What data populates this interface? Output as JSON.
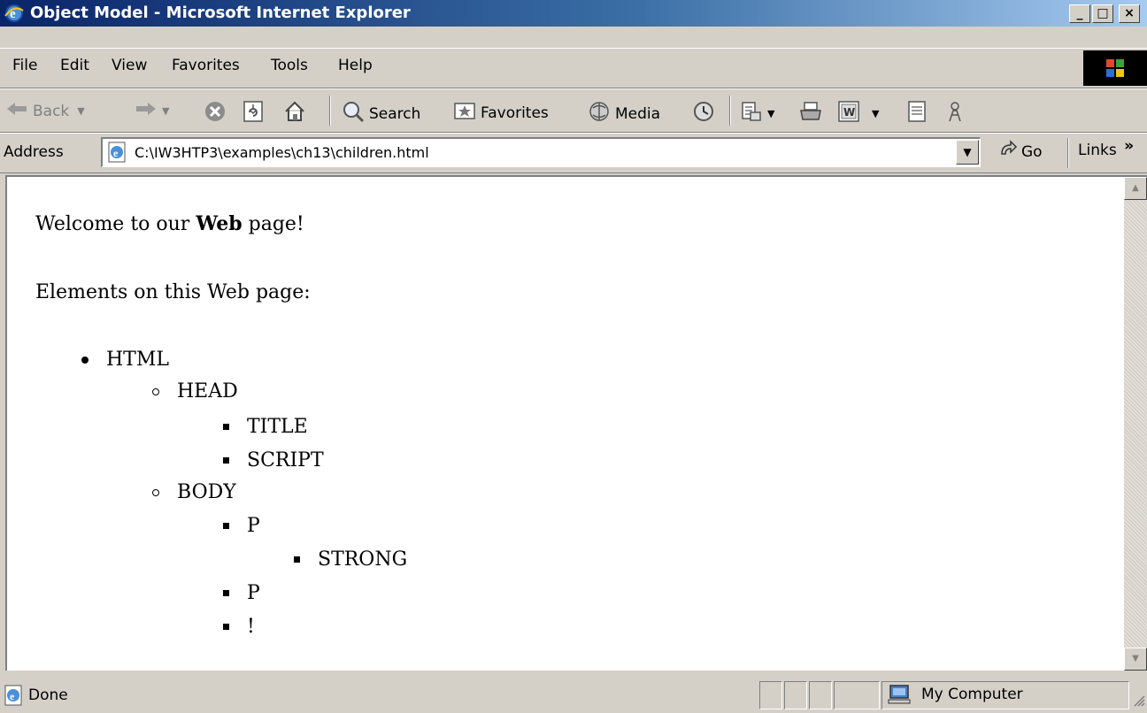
{
  "window": {
    "title": "Object Model - Microsoft Internet Explorer",
    "minimize": "_",
    "maximize": "□",
    "close": "×"
  },
  "menu": {
    "items": [
      "File",
      "Edit",
      "View",
      "Favorites",
      "Tools",
      "Help"
    ]
  },
  "toolbar": {
    "back_label": "Back",
    "search_label": "Search",
    "favorites_label": "Favorites",
    "media_label": "Media"
  },
  "address": {
    "label": "Address",
    "value": "C:\\IW3HTP3\\examples\\ch13\\children.html",
    "go_label": "Go",
    "links_label": "Links",
    "links_chevron": "»"
  },
  "page": {
    "welcome_prefix": "Welcome to our ",
    "welcome_bold": "Web",
    "welcome_suffix": " page!",
    "elements_heading": "Elements on this Web page:",
    "tree": {
      "html": "HTML",
      "head": "HEAD",
      "title": "TITLE",
      "script": "SCRIPT",
      "body": "BODY",
      "p1": "P",
      "strong": "STRONG",
      "p2": "P",
      "comment": "!"
    }
  },
  "status": {
    "text": "Done",
    "zone": "My Computer"
  },
  "colors": {
    "titlebar_start": "#0a246a",
    "titlebar_end": "#a6caf0",
    "chrome": "#d4d0c8"
  }
}
